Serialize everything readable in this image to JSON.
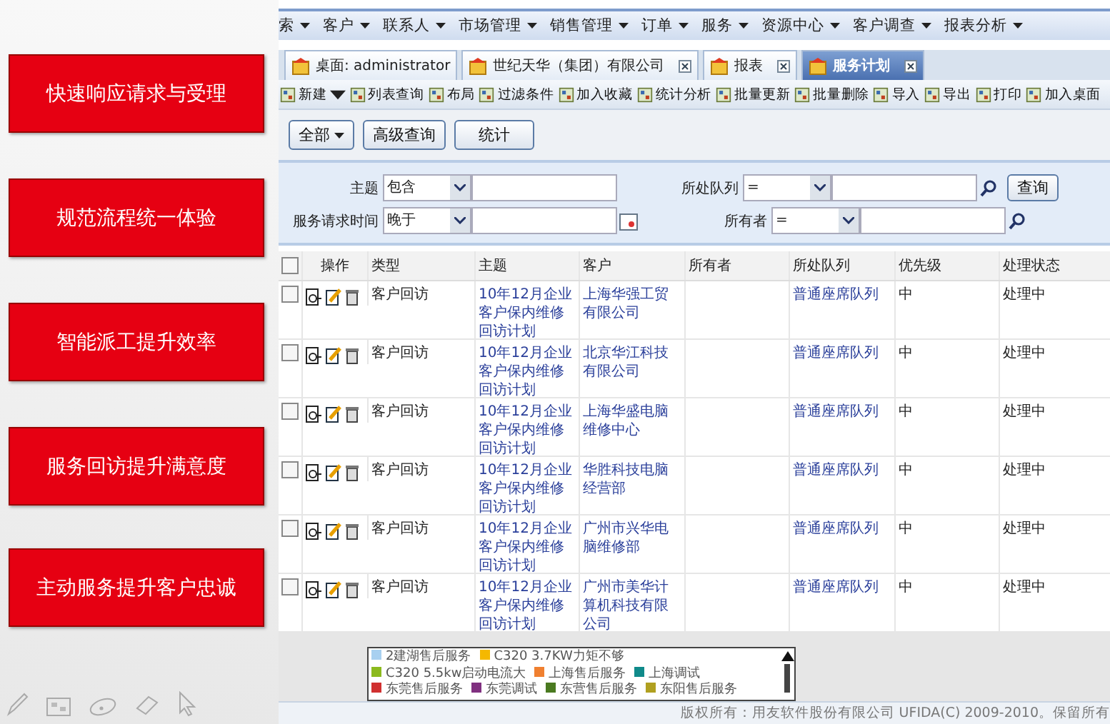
{
  "slide": {
    "highlights": [
      "快速响应请求与受理",
      "规范流程统一体验",
      "智能派工提升效率",
      "服务回访提升满意度",
      "主动服务提升客户忠诚"
    ]
  },
  "menu": [
    "索",
    "客户",
    "联系人",
    "市场管理",
    "销售管理",
    "订单",
    "服务",
    "资源中心",
    "客户调查",
    "报表分析"
  ],
  "tabs": [
    {
      "label": "桌面: administrator",
      "selected": false,
      "closable": false
    },
    {
      "label": "世纪天华（集团）有限公司",
      "selected": false,
      "closable": true
    },
    {
      "label": "报表",
      "selected": false,
      "closable": true
    },
    {
      "label": "服务计划",
      "selected": true,
      "closable": true
    }
  ],
  "toolbar": [
    {
      "label": "新建",
      "dropdown": true
    },
    {
      "label": "列表查询",
      "dropdown": false
    },
    {
      "label": "布局",
      "dropdown": false
    },
    {
      "label": "过滤条件",
      "dropdown": false
    },
    {
      "label": "加入收藏",
      "dropdown": false
    },
    {
      "label": "统计分析",
      "dropdown": false
    },
    {
      "label": "批量更新",
      "dropdown": false
    },
    {
      "label": "批量删除",
      "dropdown": false
    },
    {
      "label": "导入",
      "dropdown": false
    },
    {
      "label": "导出",
      "dropdown": false
    },
    {
      "label": "打印",
      "dropdown": false
    },
    {
      "label": "加入桌面",
      "dropdown": false
    }
  ],
  "view_select": "全部",
  "buttons": [
    "高级查询",
    "统计"
  ],
  "filters": [
    [
      {
        "label": "主题",
        "operator": "包含",
        "kind": "text"
      },
      {
        "label": "所处队列",
        "operator": "=",
        "kind": "lookup"
      }
    ],
    [
      {
        "label": "服务请求时间",
        "operator": "晚于",
        "kind": "date"
      },
      {
        "label": "所有者",
        "operator": "=",
        "kind": "lookup"
      }
    ]
  ],
  "query_button": "查询",
  "table": {
    "select_all": false,
    "columns": [
      "操作",
      "类型",
      "主题",
      "客户",
      "所有者",
      "所处队列",
      "优先级",
      "处理状态"
    ],
    "rows": [
      {
        "checked": false,
        "type": "客户回访",
        "subject": "10年12月企业客户保内维修回访计划",
        "customer": "上海华强工贸有限公司",
        "queue": "普通座席队列",
        "priority": "中",
        "status": "处理中"
      },
      {
        "checked": false,
        "type": "客户回访",
        "subject": "10年12月企业客户保内维修回访计划",
        "customer": "北京华江科技有限公司",
        "queue": "普通座席队列",
        "priority": "中",
        "status": "处理中"
      },
      {
        "checked": false,
        "type": "客户回访",
        "subject": "10年12月企业客户保内维修回访计划",
        "customer": "上海华盛电脑维修中心",
        "queue": "普通座席队列",
        "priority": "中",
        "status": "处理中"
      },
      {
        "checked": false,
        "type": "客户回访",
        "subject": "10年12月企业客户保内维修回访计划",
        "customer": "华胜科技电脑经营部",
        "queue": "普通座席队列",
        "priority": "中",
        "status": "处理中"
      },
      {
        "checked": false,
        "type": "客户回访",
        "subject": "10年12月企业客户保内维修回访计划",
        "customer": "广州市兴华电脑维修部",
        "queue": "普通座席队列",
        "priority": "中",
        "status": "处理中"
      },
      {
        "checked": false,
        "type": "客户回访",
        "subject": "10年12月企业客户保内维修回访计划",
        "customer": "广州市美华计算机科技有限公司",
        "queue": "普通座席队列",
        "priority": "中",
        "status": "处理中"
      }
    ]
  },
  "legend": [
    {
      "label": "2建湖售后服务",
      "color": "#a8d0f0"
    },
    {
      "label": "C320 3.7KW力矩不够",
      "color": "#f5b800"
    },
    {
      "label": "C320 5.5kw启动电流大",
      "color": "#8cba1e"
    },
    {
      "label": "上海售后服务",
      "color": "#f08030"
    },
    {
      "label": "上海调试",
      "color": "#108a8a"
    },
    {
      "label": "东莞售后服务",
      "color": "#d03030"
    },
    {
      "label": "东莞调试",
      "color": "#803080"
    },
    {
      "label": "东营售后服务",
      "color": "#4a7a20"
    },
    {
      "label": "东阳售后服务",
      "color": "#b0a020"
    }
  ],
  "footer": "版权所有：用友软件股份有限公司 UFIDA(C) 2009-2010。保留所有"
}
